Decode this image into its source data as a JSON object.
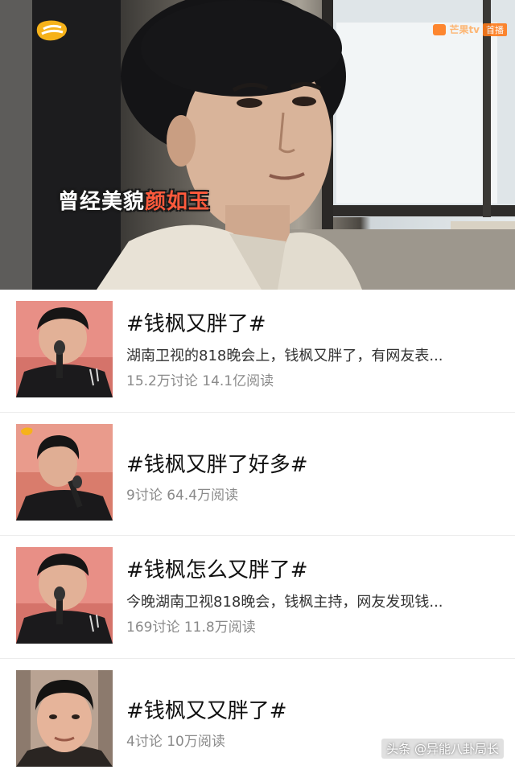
{
  "video": {
    "subtitle_part1": "曾经美貌",
    "subtitle_part2": "颜如玉",
    "badge_app": "芒果tv",
    "badge_tag": "首播"
  },
  "topics": [
    {
      "title": "#钱枫又胖了#",
      "description": "湖南卫视的818晚会上，钱枫又胖了，有网友表...",
      "stats": "15.2万讨论 14.1亿阅读"
    },
    {
      "title": "#钱枫又胖了好多#",
      "description": "",
      "stats": "9讨论 64.4万阅读"
    },
    {
      "title": "#钱枫怎么又胖了#",
      "description": "今晚湖南卫视818晚会，钱枫主持，网友发现钱...",
      "stats": "169讨论 11.8万阅读"
    },
    {
      "title": "#钱枫又又胖了#",
      "description": "",
      "stats": "4讨论 10万阅读"
    }
  ],
  "watermark": "头条 @异能八卦局长",
  "colors": {
    "subtitle_highlight": "#ff5a3c",
    "stats_gray": "#8a8a8a",
    "logo_orange": "#ff7a1a"
  }
}
